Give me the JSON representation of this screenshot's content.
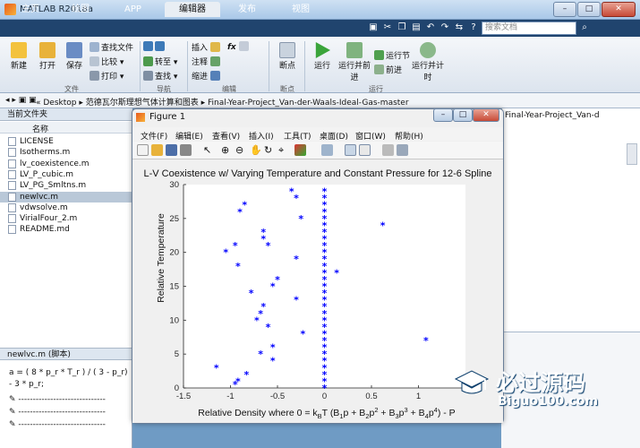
{
  "window": {
    "title": "MATLAB R2018a",
    "minimize": "–",
    "maximize": "□",
    "close": "✕"
  },
  "tabs": [
    "主页",
    "绘图",
    "APP",
    "编辑器",
    "发布",
    "视图"
  ],
  "search": {
    "placeholder": "搜索文档"
  },
  "ribbon": {
    "file": {
      "new": "新建",
      "open": "打开",
      "save": "保存",
      "find_files": "查找文件",
      "compare": "比较",
      "print": "打印",
      "section": "文件"
    },
    "nav": {
      "goto": "转至",
      "find": "查找",
      "section": "导航"
    },
    "edit": {
      "insert": "插入",
      "comment": "注释",
      "indent": "缩进",
      "fx": "fx",
      "section": "编辑"
    },
    "breakpoint": {
      "label": "断点",
      "section": "断点"
    },
    "run": {
      "run": "运行",
      "run_advance": "运行并前进",
      "run_section": "运行节",
      "advance": "前进",
      "run_time": "运行并计时",
      "section": "运行"
    }
  },
  "address": {
    "path": "«  Desktop  ▸  范德瓦尔斯理想气体计算和图表  ▸  Final-Year-Project_Van-der-Waals-Ideal-Gas-master"
  },
  "current_folder": {
    "header": "当前文件夹",
    "col_name": "名称",
    "files": [
      "LICENSE",
      "Isotherms.m",
      "lv_coexistence.m",
      "LV_P_cubic.m",
      "LV_PG_Smltns.m",
      "newlvc.m",
      "vdwsolve.m",
      "VirialFour_2.m",
      "README.md"
    ],
    "selected": "newlvc.m"
  },
  "details": {
    "header": "newlvc.m  (脚本)",
    "code": [
      "a = ( 8 * p_r * T_r ) / ( 3 - p_r)",
      "- 3 * p_r;",
      "------------------------------",
      "------------------------------",
      "------------------------------"
    ]
  },
  "editor": {
    "tab": "Final-Year-Project_Van-d"
  },
  "figure": {
    "title": "Figure 1",
    "menu": [
      "文件(F)",
      "编辑(E)",
      "查看(V)",
      "插入(I)",
      "工具(T)",
      "桌面(D)",
      "窗口(W)",
      "帮助(H)"
    ]
  },
  "chart_data": {
    "type": "scatter",
    "title": "L-V Coexistence w/ Varying Temperature and Constant Pressure for 12-6 Spline",
    "xlabel": "Relative Density where 0 = k",
    "xlabel_parts": [
      "B",
      "T (B",
      "1",
      "p + B",
      "2",
      "p",
      "2",
      " + B",
      "3",
      "p",
      "3",
      " + B",
      "4",
      "p",
      "4",
      ") - P"
    ],
    "ylabel": "Relative Temperature",
    "xlim": [
      -1.5,
      1.5
    ],
    "ylim": [
      0,
      30
    ],
    "xticks": [
      "-1.5",
      "-1",
      "-0.5",
      "0",
      "0.5",
      "1"
    ],
    "yticks": [
      "0",
      "5",
      "10",
      "15",
      "20",
      "25",
      "30"
    ],
    "marker": "*",
    "color": "#0000ff",
    "points": [
      [
        -0.35,
        29
      ],
      [
        -0.3,
        28
      ],
      [
        -0.85,
        27
      ],
      [
        -0.9,
        26
      ],
      [
        -0.25,
        25
      ],
      [
        -0.65,
        23
      ],
      [
        0.62,
        24
      ],
      [
        -0.65,
        22
      ],
      [
        -0.6,
        21
      ],
      [
        -0.95,
        21
      ],
      [
        -1.05,
        20
      ],
      [
        -0.3,
        19
      ],
      [
        -0.92,
        18
      ],
      [
        0.13,
        17
      ],
      [
        -0.5,
        16
      ],
      [
        -0.55,
        15
      ],
      [
        -0.78,
        14
      ],
      [
        -0.3,
        13
      ],
      [
        -0.65,
        12
      ],
      [
        -0.68,
        11
      ],
      [
        -0.72,
        10
      ],
      [
        -0.6,
        9
      ],
      [
        -0.23,
        8
      ],
      [
        1.08,
        7
      ],
      [
        -0.55,
        6
      ],
      [
        -0.68,
        5
      ],
      [
        -0.55,
        4
      ],
      [
        -1.15,
        3
      ],
      [
        -0.83,
        2
      ],
      [
        -0.92,
        1
      ],
      [
        -0.95,
        0.5
      ],
      [
        0,
        0
      ],
      [
        0,
        1
      ],
      [
        0,
        2
      ],
      [
        0,
        3
      ],
      [
        0,
        4
      ],
      [
        0,
        5
      ],
      [
        0,
        6
      ],
      [
        0,
        7
      ],
      [
        0,
        8
      ],
      [
        0,
        9
      ],
      [
        0,
        10
      ],
      [
        0,
        11
      ],
      [
        0,
        12
      ],
      [
        0,
        13
      ],
      [
        0,
        14
      ],
      [
        0,
        15
      ],
      [
        0,
        16
      ],
      [
        0,
        17
      ],
      [
        0,
        18
      ],
      [
        0,
        19
      ],
      [
        0,
        20
      ],
      [
        0,
        21
      ],
      [
        0,
        22
      ],
      [
        0,
        23
      ],
      [
        0,
        24
      ],
      [
        0,
        25
      ],
      [
        0,
        26
      ],
      [
        0,
        27
      ],
      [
        0,
        28
      ],
      [
        0,
        29
      ]
    ]
  },
  "watermark": {
    "text": "必过源码",
    "url": "Biguo100.com"
  }
}
